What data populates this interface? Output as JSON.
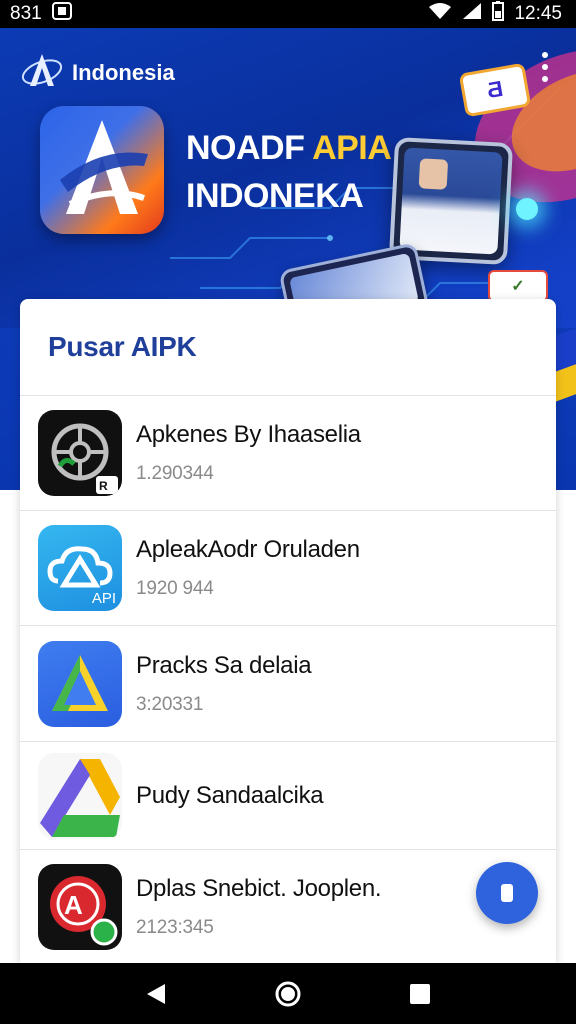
{
  "status_bar": {
    "time_left": "831",
    "time_right": "12:45"
  },
  "header": {
    "brand_name": "Indonesia",
    "hero_title_line1_a": "NOADF",
    "hero_title_line1_b": "APIA",
    "hero_title_line2": "INDONEKA"
  },
  "section": {
    "title": "Pusar AIPK"
  },
  "apps": [
    {
      "name": "Apkenes By Ihaaselia",
      "version": "1.290344",
      "icon": "dark-wheel-icon",
      "badge": ""
    },
    {
      "name": "ApleakAodr Oruladen",
      "version": "1920 944",
      "icon": "cloud-icon",
      "badge": "API"
    },
    {
      "name": "Pracks Sa delaia",
      "version": "3:20331",
      "icon": "triangle-logo-icon",
      "badge": ""
    },
    {
      "name": "Pudy Sandaalcika",
      "version": "",
      "icon": "drive-triangle-icon",
      "badge": ""
    },
    {
      "name": "Dplas Snebict. Jooplen.",
      "version": "2123:345",
      "icon": "red-a-icon",
      "badge": ""
    }
  ],
  "colors": {
    "hero_blue": "#0c3bb5",
    "title_blue": "#1f3f9a",
    "fab_blue": "#2f63dd",
    "accent_yellow": "#ffcc33"
  }
}
